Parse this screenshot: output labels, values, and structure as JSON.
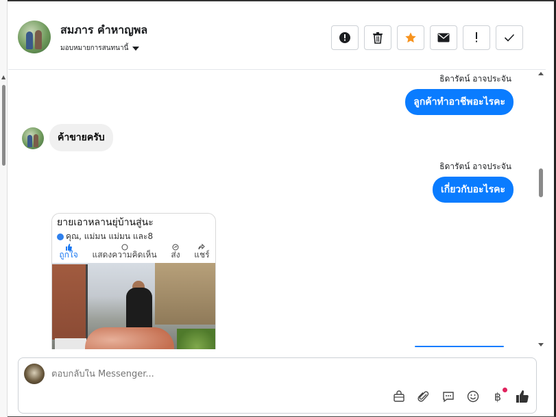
{
  "header": {
    "contact_name": "สมภาร คำหาญพล",
    "assign_label": "มอบหมายการสนทนานี้",
    "actions": [
      {
        "icon": "alert-circle-icon",
        "label": ""
      },
      {
        "icon": "trash-icon",
        "label": ""
      },
      {
        "icon": "star-icon",
        "label": ""
      },
      {
        "icon": "mail-icon",
        "label": ""
      },
      {
        "icon": "exclamation-icon",
        "label": ""
      },
      {
        "icon": "check-icon",
        "label": ""
      }
    ],
    "star_color": "#f7931e"
  },
  "thread": {
    "messages": [
      {
        "direction": "out",
        "sender": "ธิดารัตน์ อาจประจัน",
        "text": "ลูกค้าทำอาชีพอะไรคะ"
      },
      {
        "direction": "in",
        "text": "ค้าขายครับ"
      },
      {
        "direction": "out",
        "sender": "ธิดารัตน์ อาจประจัน",
        "text": "เกี่ยวกับอะไรคะ"
      }
    ],
    "attachment": {
      "post_title": "ยายเอาหลานยุ่บ้านสู่นะ",
      "reactions": "คุณ, แม่มน แม่มน และ8",
      "actions": [
        "ถูกใจ",
        "แสดงความคิดเห็น",
        "ส่ง",
        "แชร์"
      ]
    },
    "bubble_color": "#0a7cff"
  },
  "composer": {
    "placeholder": "ตอบกลับใน Messenger...",
    "tools": [
      "bag-icon",
      "paperclip-icon",
      "chat-icon",
      "emoji-icon",
      "baht-icon",
      "thumbs-up-icon"
    ],
    "baht_symbol": "฿"
  }
}
